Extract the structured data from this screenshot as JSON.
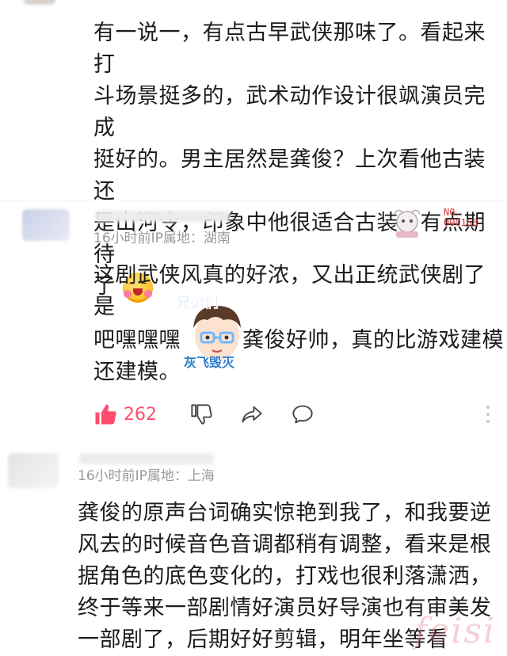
{
  "comments": [
    {
      "text_lines": [
        "有一说一，有点古早武侠那味了。看起来打",
        "斗场景挺多的，武术动作设计很飒演员完成",
        "挺好的。男主居然是龚俊？上次看他古装还",
        "是山河令，印象中他很适合古装，有点期待",
        "了"
      ],
      "emoji": "hugging-emoji"
    },
    {
      "meta": "16小时前IP属地：湖南",
      "line1": "这剧武侠风真的好浓，又出正统武侠剧了是",
      "line2_a": "吧嘿嘿嘿",
      "line2_b": "龚俊好帅，真的比游戏建模",
      "line3": "还建模。",
      "sticker_text_top": "兄弟们",
      "sticker_text_bottom": "灰飞毁灭",
      "badge_text": "NO.\n000168",
      "likes": "262"
    },
    {
      "meta": "16小时前IP属地：上海",
      "text_lines": [
        "龚俊的原声台词确实惊艳到我了，和我要逆",
        "风去的时候音色音调都稍有调整，看来是根",
        "据角色的底色变化的，打戏也很利落潇洒，",
        "终于等来一部剧情好演员好导演也有审美发",
        "一部剧了，后期好好剪辑，明年坐等看"
      ]
    }
  ],
  "watermark": "feisi",
  "colors": {
    "like": "#ff4d6d",
    "meta": "#9a9a9a",
    "text": "#1c1c1c"
  }
}
